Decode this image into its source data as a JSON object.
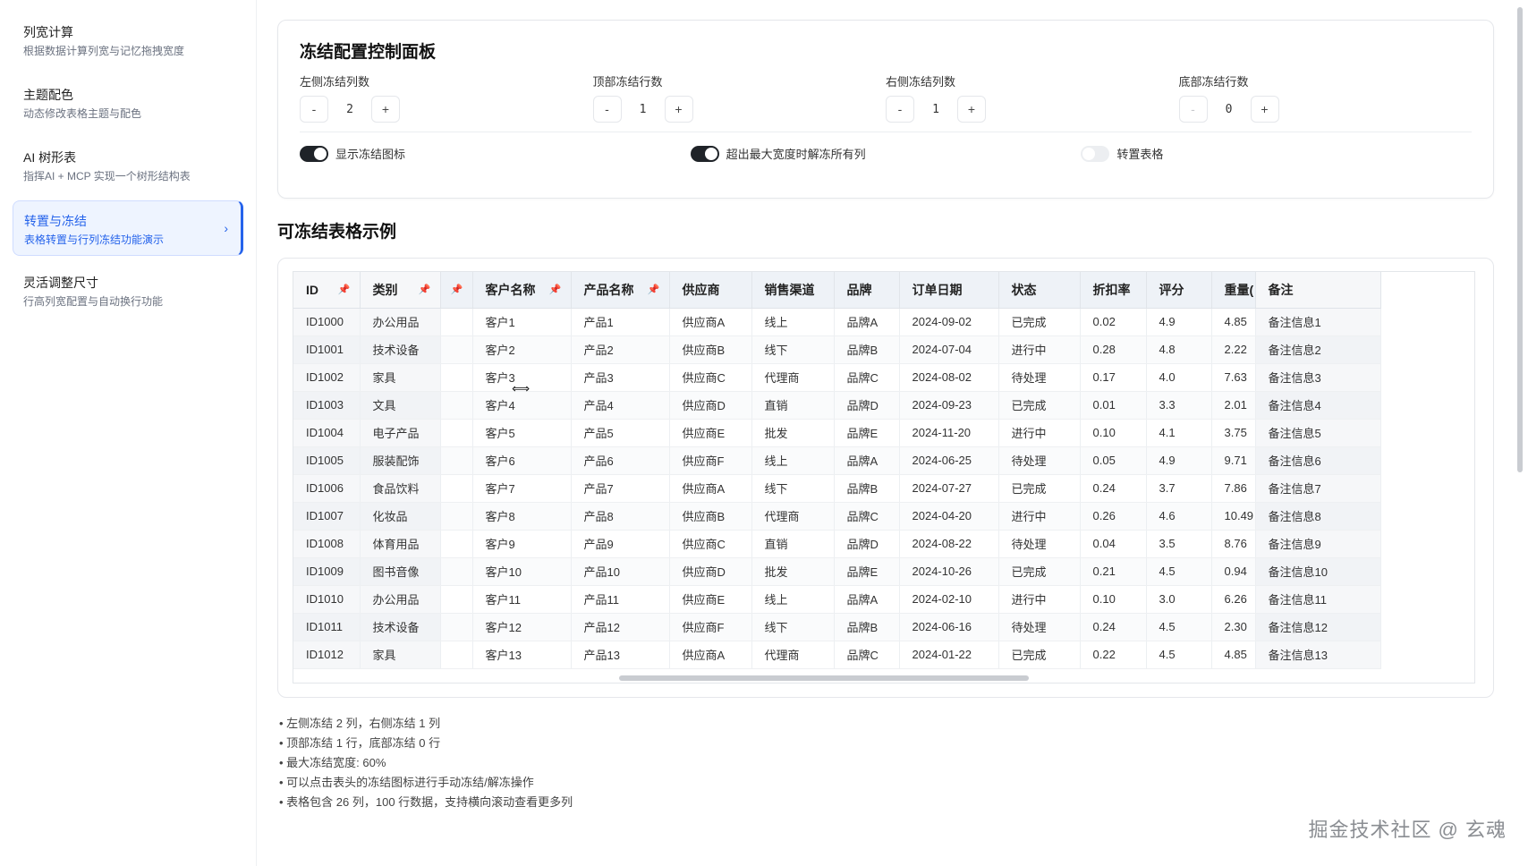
{
  "sidebar": {
    "items": [
      {
        "title": "列宽计算",
        "desc": "根据数据计算列宽与记忆拖拽宽度"
      },
      {
        "title": "主题配色",
        "desc": "动态修改表格主题与配色"
      },
      {
        "title": "AI 树形表",
        "desc": "指挥AI + MCP 实现一个树形结构表"
      },
      {
        "title": "转置与冻结",
        "desc": "表格转置与行列冻结功能演示",
        "active": true
      },
      {
        "title": "灵活调整尺寸",
        "desc": "行高列宽配置与自动换行功能"
      }
    ]
  },
  "panel": {
    "title": "冻结配置控制面板",
    "controls": [
      {
        "label": "左侧冻结列数",
        "minus": "-",
        "value": "2",
        "plus": "+"
      },
      {
        "label": "顶部冻结行数",
        "minus": "-",
        "value": "1",
        "plus": "+"
      },
      {
        "label": "右侧冻结列数",
        "minus": "-",
        "value": "1",
        "plus": "+"
      },
      {
        "label": "底部冻结行数",
        "minus": "-",
        "value": "0",
        "plus": "+"
      }
    ],
    "toggles": [
      {
        "label": "显示冻结图标",
        "on": true
      },
      {
        "label": "超出最大宽度时解冻所有列",
        "on": true
      },
      {
        "label": "转置表格",
        "on": false
      }
    ]
  },
  "table_section": {
    "title": "可冻结表格示例",
    "columns": [
      "ID",
      "类别",
      "",
      "客户名称",
      "产品名称",
      "供应商",
      "销售渠道",
      "品牌",
      "订单日期",
      "状态",
      "折扣率",
      "评分",
      "重量(",
      "备注"
    ],
    "rows": [
      [
        "ID1000",
        "办公用品",
        "",
        "客户1",
        "产品1",
        "供应商A",
        "线上",
        "品牌A",
        "2024-09-02",
        "已完成",
        "0.02",
        "4.9",
        "4.85",
        "备注信息1"
      ],
      [
        "ID1001",
        "技术设备",
        "",
        "客户2",
        "产品2",
        "供应商B",
        "线下",
        "品牌B",
        "2024-07-04",
        "进行中",
        "0.28",
        "4.8",
        "2.22",
        "备注信息2"
      ],
      [
        "ID1002",
        "家具",
        "",
        "客户3",
        "产品3",
        "供应商C",
        "代理商",
        "品牌C",
        "2024-08-02",
        "待处理",
        "0.17",
        "4.0",
        "7.63",
        "备注信息3"
      ],
      [
        "ID1003",
        "文具",
        "",
        "客户4",
        "产品4",
        "供应商D",
        "直销",
        "品牌D",
        "2024-09-23",
        "已完成",
        "0.01",
        "3.3",
        "2.01",
        "备注信息4"
      ],
      [
        "ID1004",
        "电子产品",
        "",
        "客户5",
        "产品5",
        "供应商E",
        "批发",
        "品牌E",
        "2024-11-20",
        "进行中",
        "0.10",
        "4.1",
        "3.75",
        "备注信息5"
      ],
      [
        "ID1005",
        "服装配饰",
        "",
        "客户6",
        "产品6",
        "供应商F",
        "线上",
        "品牌A",
        "2024-06-25",
        "待处理",
        "0.05",
        "4.9",
        "9.71",
        "备注信息6"
      ],
      [
        "ID1006",
        "食品饮料",
        "",
        "客户7",
        "产品7",
        "供应商A",
        "线下",
        "品牌B",
        "2024-07-27",
        "已完成",
        "0.24",
        "3.7",
        "7.86",
        "备注信息7"
      ],
      [
        "ID1007",
        "化妆品",
        "",
        "客户8",
        "产品8",
        "供应商B",
        "代理商",
        "品牌C",
        "2024-04-20",
        "进行中",
        "0.26",
        "4.6",
        "10.49",
        "备注信息8"
      ],
      [
        "ID1008",
        "体育用品",
        "",
        "客户9",
        "产品9",
        "供应商C",
        "直销",
        "品牌D",
        "2024-08-22",
        "待处理",
        "0.04",
        "3.5",
        "8.76",
        "备注信息9"
      ],
      [
        "ID1009",
        "图书音像",
        "",
        "客户10",
        "产品10",
        "供应商D",
        "批发",
        "品牌E",
        "2024-10-26",
        "已完成",
        "0.21",
        "4.5",
        "0.94",
        "备注信息10"
      ],
      [
        "ID1010",
        "办公用品",
        "",
        "客户11",
        "产品11",
        "供应商E",
        "线上",
        "品牌A",
        "2024-02-10",
        "进行中",
        "0.10",
        "3.0",
        "6.26",
        "备注信息11"
      ],
      [
        "ID1011",
        "技术设备",
        "",
        "客户12",
        "产品12",
        "供应商F",
        "线下",
        "品牌B",
        "2024-06-16",
        "待处理",
        "0.24",
        "4.5",
        "2.30",
        "备注信息12"
      ],
      [
        "ID1012",
        "家具",
        "",
        "客户13",
        "产品13",
        "供应商A",
        "代理商",
        "品牌C",
        "2024-01-22",
        "已完成",
        "0.22",
        "4.5",
        "4.85",
        "备注信息13"
      ]
    ]
  },
  "notes": [
    "左侧冻结 2 列，右侧冻结 1 列",
    "顶部冻结 1 行，底部冻结 0 行",
    "最大冻结宽度: 60%",
    "可以点击表头的冻结图标进行手动冻结/解冻操作",
    "表格包含 26 列，100 行数据，支持横向滚动查看更多列"
  ],
  "watermark": "掘金技术社区 @ 玄魂",
  "icons": {
    "pin": "pin-icon",
    "chevron": "chevron-right-icon"
  }
}
